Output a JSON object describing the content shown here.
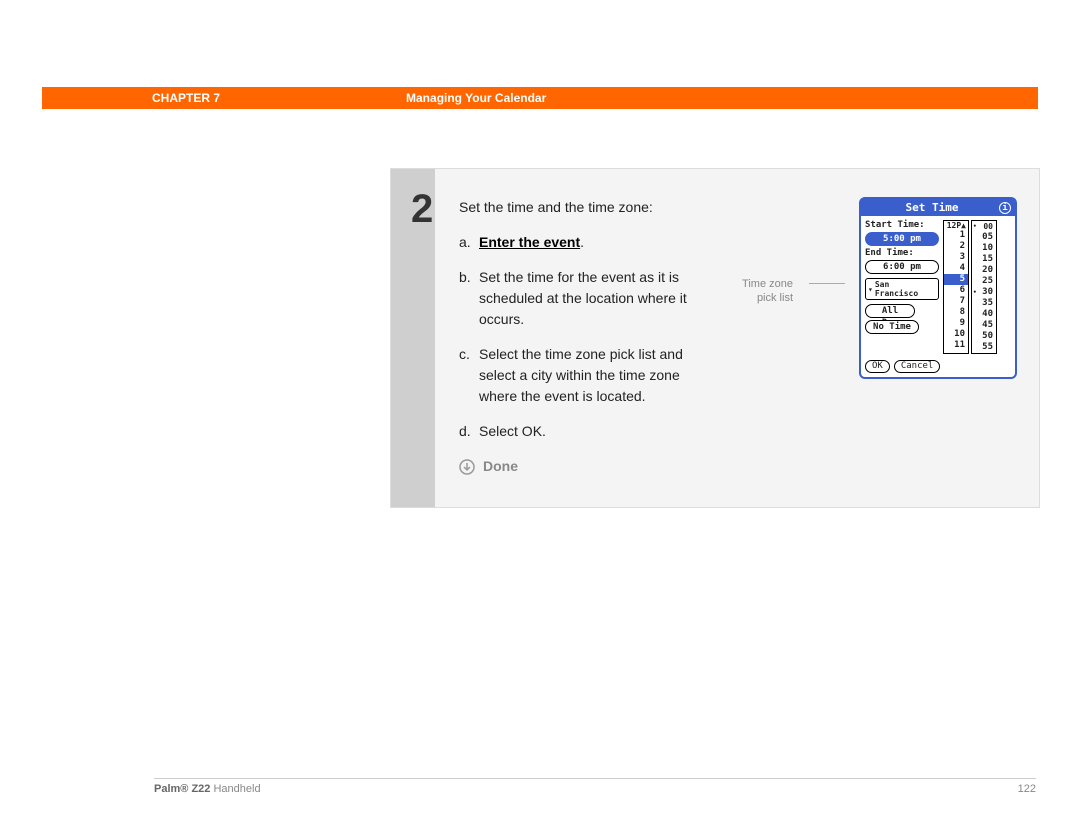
{
  "header": {
    "chapter": "CHAPTER 7",
    "title": "Managing Your Calendar"
  },
  "step": {
    "number": "2",
    "intro": "Set the time and the time zone:",
    "items": [
      {
        "marker": "a.",
        "plain_before": "",
        "link": "Enter the event",
        "plain_after": "."
      },
      {
        "marker": "b.",
        "text": "Set the time for the event as it is scheduled at the location where it occurs."
      },
      {
        "marker": "c.",
        "text": "Select the time zone pick list and select a city within the time zone where the event is located."
      },
      {
        "marker": "d.",
        "text": "Select OK."
      }
    ],
    "done": "Done"
  },
  "annotation": {
    "label": "Time zone pick list"
  },
  "palm": {
    "title": "Set Time",
    "start_label": "Start Time:",
    "start_value": "5:00 pm",
    "end_label": "End Time:",
    "end_value": "6:00 pm",
    "tz_value": "San Francisco",
    "all_day": "All Day",
    "no_time": "No Time",
    "ok": "OK",
    "cancel": "Cancel",
    "hour_hdr": "12P▲",
    "min_hdr": "00",
    "hours": [
      "1",
      "2",
      "3",
      "4",
      "5",
      "6",
      "7",
      "8",
      "9",
      "10",
      "11"
    ],
    "minutes": [
      "05",
      "10",
      "15",
      "20",
      "25",
      "30",
      "35",
      "40",
      "45",
      "50",
      "55"
    ],
    "hour_selected": "5",
    "min_dots": [
      "00",
      "30"
    ]
  },
  "footer": {
    "product_bold": "Palm® Z22",
    "product_rest": " Handheld",
    "page": "122"
  }
}
